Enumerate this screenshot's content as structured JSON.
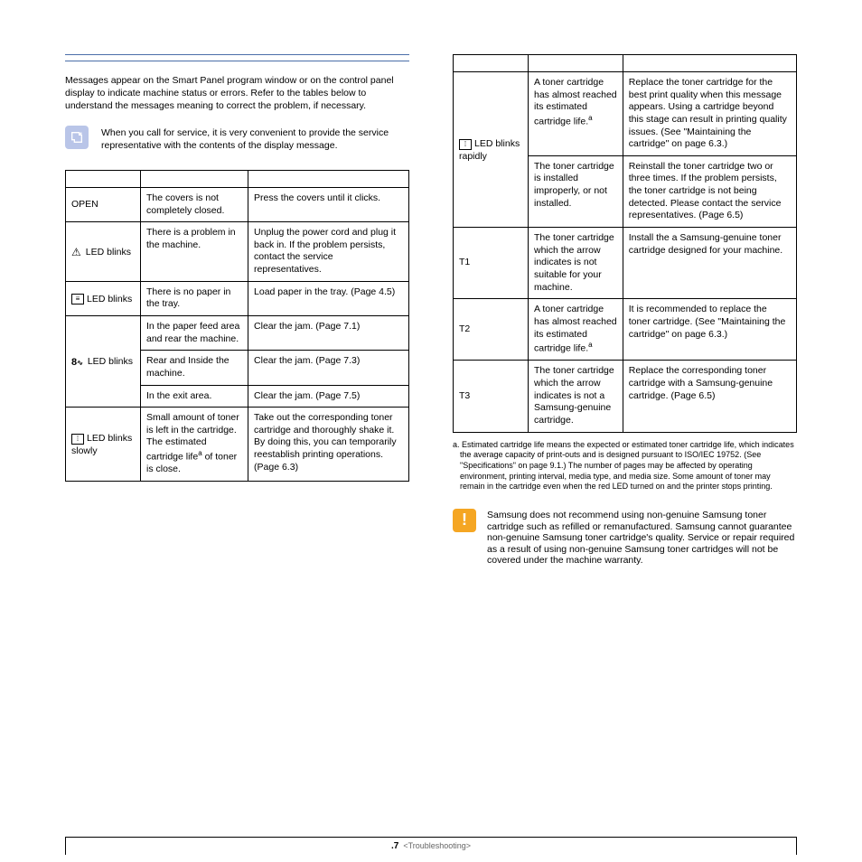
{
  "intro": "Messages appear on the Smart Panel program window or on the control panel display to indicate machine status or errors. Refer to the tables below to understand the messages meaning to correct the problem, if necessary.",
  "note": "When you call for service, it is very convenient to provide the service representative with the contents of the display message.",
  "left_table": [
    {
      "display": "OPEN",
      "icon": "none",
      "sub": "",
      "meaning": "The covers is not completely closed.",
      "solution": "Press the covers until it clicks."
    },
    {
      "display": "LED blinks",
      "icon": "warn",
      "sub": "",
      "meaning": "There is a problem in the machine.",
      "solution": "Unplug the power cord and plug it back in. If the problem persists, contact the service representatives."
    },
    {
      "display": "LED blinks",
      "icon": "paper",
      "sub": "",
      "meaning": "There is no paper in the tray.",
      "solution": "Load paper in the tray. (Page 4.5)"
    },
    {
      "display": "LED blinks",
      "icon": "jam",
      "sub": "",
      "rowspan": 3,
      "rows": [
        {
          "meaning": "In the paper feed area and rear the machine.",
          "solution": "Clear the jam. (Page 7.1)"
        },
        {
          "meaning": "Rear and Inside the machine.",
          "solution": "Clear the jam. (Page 7.3)"
        },
        {
          "meaning": "In the exit area.",
          "solution": "Clear the jam. (Page 7.5)"
        }
      ]
    },
    {
      "display": "LED blinks",
      "icon": "toner",
      "sub": "slowly",
      "meaning_html": "Small amount of toner is left in the cartridge. The estimated cartridge life<sup>a</sup> of toner is close.",
      "solution": "Take out the corresponding toner cartridge and thoroughly shake it. By doing this, you can temporarily reestablish printing operations. (Page 6.3)"
    }
  ],
  "right_table": [
    {
      "display": "LED blinks",
      "icon": "toner",
      "sub": "rapidly",
      "rowspan": 2,
      "rows": [
        {
          "meaning_html": "A toner cartridge has almost reached its estimated cartridge life.<sup>a</sup>",
          "solution": "Replace the toner cartridge for the best print quality when this message appears. Using a cartridge beyond this stage can result in printing quality issues. (See \"Maintaining the cartridge\" on page 6.3.)"
        },
        {
          "meaning": "The toner cartridge is installed improperly, or not installed.",
          "solution": "Reinstall the toner cartridge two or three times. If the problem persists, the toner cartridge is not being detected. Please contact the service representatives. (Page 6.5)"
        }
      ]
    },
    {
      "display": "T1",
      "icon": "none",
      "sub": "",
      "meaning": "The toner cartridge which the arrow indicates is not suitable for your machine.",
      "solution": "Install the a Samsung-genuine toner cartridge designed for your machine."
    },
    {
      "display": "T2",
      "icon": "none",
      "sub": "",
      "meaning_html": "A toner cartridge has almost reached its estimated cartridge life.<sup>a</sup>",
      "solution": " It is recommended to replace the toner cartridge. (See \"Maintaining the cartridge\" on page 6.3.)"
    },
    {
      "display": "T3",
      "icon": "none",
      "sub": "",
      "meaning": "The toner cartridge which the arrow indicates is not a Samsung-genuine cartridge.",
      "solution": "Replace the corresponding toner cartridge with a Samsung-genuine cartridge. (Page 6.5)"
    }
  ],
  "footnote": "a. Estimated cartridge life means the expected or estimated toner cartridge life, which indicates the average capacity of print-outs and is designed pursuant to ISO/IEC 19752. (See \"Specifications\" on page 9.1.) The number of pages may be affected by operating environment, printing interval, media type, and media size. Some amount of toner may remain in the cartridge even when the red LED turned on and the printer stops printing.",
  "warning": "Samsung does not recommend using non-genuine Samsung toner cartridge such as refilled or remanufactured. Samsung cannot guarantee non-genuine Samsung toner cartridge's quality. Service or repair required as a result of using non-genuine Samsung toner cartridges will not be covered under the machine warranty.",
  "footer": {
    "page": ".7",
    "section": "<Troubleshooting>"
  }
}
